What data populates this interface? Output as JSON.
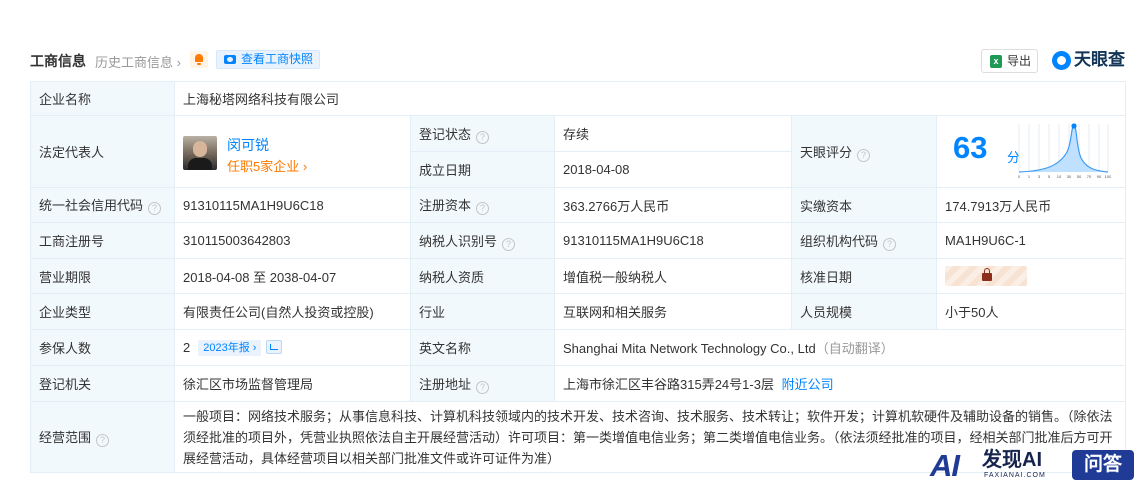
{
  "header": {
    "title": "工商信息",
    "history": "历史工商信息",
    "history_arrow": "›",
    "snapshot": "查看工商快照",
    "export": "导出",
    "export_icon": "x",
    "brand": "天眼查"
  },
  "company": {
    "name_label": "企业名称",
    "name": "上海秘塔网络科技有限公司"
  },
  "legal": {
    "label": "法定代表人",
    "name": "闵可锐",
    "sub": "任职5家企业 ›"
  },
  "rows": {
    "status_label": "登记状态",
    "status": "存续",
    "founded_label": "成立日期",
    "founded": "2018-04-08",
    "score_label": "天眼评分",
    "score": "63",
    "score_unit": "分",
    "credit_label": "统一社会信用代码",
    "credit": "91310115MA1H9U6C18",
    "reg_cap_label": "注册资本",
    "reg_cap": "363.2766万人民币",
    "paid_cap_label": "实缴资本",
    "paid_cap": "174.7913万人民币",
    "reg_no_label": "工商注册号",
    "reg_no": "310115003642803",
    "tax_id_label": "纳税人识别号",
    "tax_id": "91310115MA1H9U6C18",
    "org_code_label": "组织机构代码",
    "org_code": "MA1H9U6C-1",
    "term_label": "营业期限",
    "term": "2018-04-08 至 2038-04-07",
    "taxpayer_label": "纳税人资质",
    "taxpayer": "增值税一般纳税人",
    "approval_label": "核准日期",
    "type_label": "企业类型",
    "type": "有限责任公司(自然人投资或控股)",
    "industry_label": "行业",
    "industry": "互联网和相关服务",
    "staff_label": "人员规模",
    "staff": "小于50人",
    "insured_label": "参保人数",
    "insured": "2",
    "insured_year": "2023年报",
    "insured_year_arrow": "›",
    "english_label": "英文名称",
    "english": "Shanghai Mita Network Technology Co., Ltd",
    "english_note": "（自动翻译）",
    "authority_label": "登记机关",
    "authority": "徐汇区市场监督管理局",
    "address_label": "注册地址",
    "address": "上海市徐汇区丰谷路315弄24号1-3层",
    "nearby": "附近公司",
    "scope_label": "经营范围",
    "scope": "一般项目：网络技术服务；从事信息科技、计算机科技领域内的技术开发、技术咨询、技术服务、技术转让；软件开发；计算机软硬件及辅助设备的销售。（除依法须经批准的项目外，凭营业执照依法自主开展经营活动）许可项目：第一类增值电信业务；第二类增值电信业务。（依法须经批准的项目，经相关部门批准后方可开展经营活动，具体经营项目以相关部门批准文件或许可证件为准）"
  },
  "help_glyph": "?",
  "score_chart": {
    "ticks": [
      "0",
      "1",
      "3",
      "5",
      "10",
      "30",
      "50",
      "70",
      "90",
      "100"
    ]
  },
  "watermark": {
    "ai": "AI",
    "main": "发现AI",
    "sub": "FAXIANAI.COM",
    "button": "问答"
  },
  "colors": {
    "accent": "#0084ff",
    "label_bg": "#f2f9fc",
    "status_green": "#00a65a",
    "orange": "#ff7a00"
  }
}
